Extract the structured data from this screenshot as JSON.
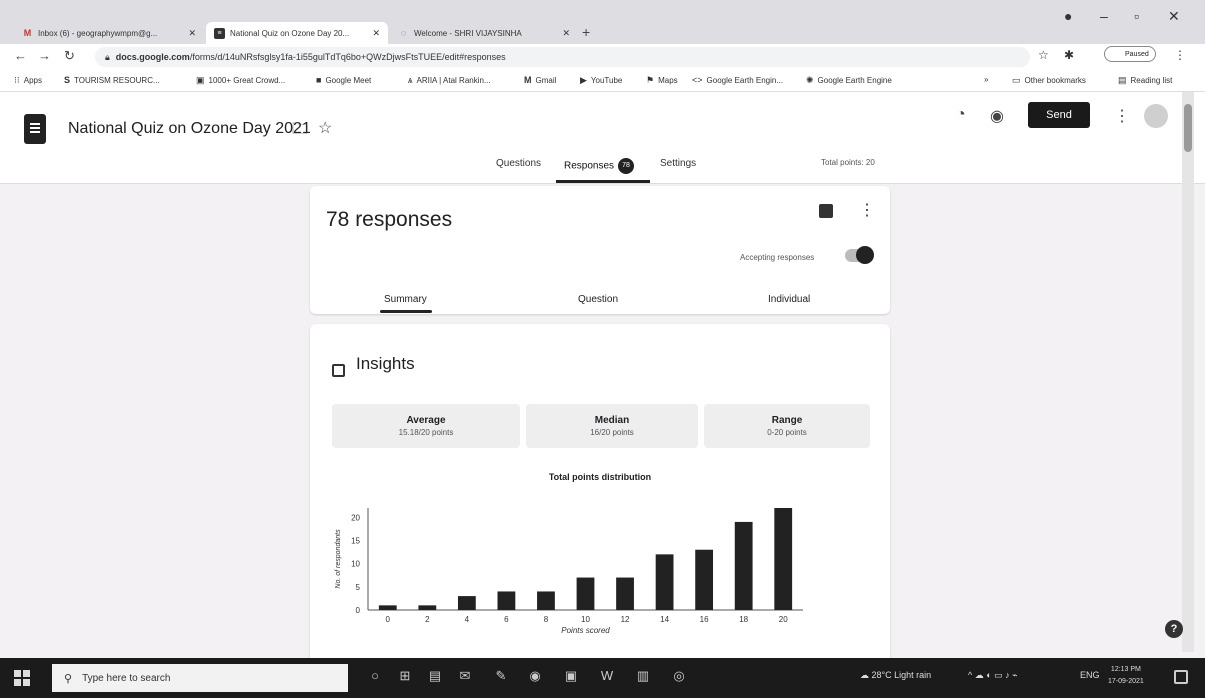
{
  "browser": {
    "tabs": [
      {
        "title": "Inbox (6) - geographywmpm@g...",
        "icon": "gmail-icon"
      },
      {
        "title": "National Quiz on Ozone Day 20...",
        "icon": "forms-icon",
        "active": true
      },
      {
        "title": "Welcome - SHRI VIJAYSINHA",
        "icon": "globe-icon"
      }
    ],
    "url_prefix": "docs.google.com",
    "url_rest": "/forms/d/14uNRsfsglsy1fa-1i55gulTdTq6bo+QWzDjwsFtsTUEE/edit#responses",
    "profile": "Paused",
    "bookmarks": [
      {
        "label": "Apps",
        "icon": "apps-icon"
      },
      {
        "label": "TOURISM RESOURC...",
        "icon": "s-icon"
      },
      {
        "label": "1000+ Great Crowd...",
        "icon": "bookmark-icon"
      },
      {
        "label": "Google Meet",
        "icon": "meet-icon"
      },
      {
        "label": "ARIIA | Atal Rankin...",
        "icon": "ariia-icon"
      },
      {
        "label": "Gmail",
        "icon": "gmail-icon"
      },
      {
        "label": "YouTube",
        "icon": "youtube-icon"
      },
      {
        "label": "Maps",
        "icon": "maps-icon"
      },
      {
        "label": "Google Earth Engin...",
        "icon": "code-icon"
      },
      {
        "label": "Google Earth Engine",
        "icon": "earth-icon"
      }
    ],
    "other_bookmarks": "Other bookmarks",
    "reading_list": "Reading list",
    "more_bookmarks": "»"
  },
  "form": {
    "title": "National Quiz on Ozone Day 2021",
    "send_label": "Send",
    "tabs": {
      "questions": "Questions",
      "responses": "Responses",
      "settings": "Settings"
    },
    "responses_badge": "78",
    "total_points": "Total points: 20"
  },
  "responses_card": {
    "count_text": "78 responses",
    "accepting_text": "Accepting responses",
    "subtabs": {
      "summary": "Summary",
      "question": "Question",
      "individual": "Individual"
    }
  },
  "insights": {
    "title": "Insights",
    "stats": [
      {
        "label": "Average",
        "value": "15.18/20 points"
      },
      {
        "label": "Median",
        "value": "16/20 points"
      },
      {
        "label": "Range",
        "value": "0-20 points"
      }
    ]
  },
  "chart_data": {
    "type": "bar",
    "title": "Total points distribution",
    "xlabel": "Points scored",
    "ylabel": "No. of respondants",
    "categories": [
      "0",
      "2",
      "4",
      "6",
      "8",
      "10",
      "12",
      "14",
      "16",
      "18",
      "20"
    ],
    "values": [
      1,
      1,
      3,
      4,
      4,
      7,
      7,
      12,
      13,
      19,
      22
    ],
    "yticks": [
      0,
      5,
      10,
      15,
      20
    ],
    "ylim": [
      0,
      22
    ],
    "bar_color": "#222222"
  },
  "taskbar": {
    "search_placeholder": "Type here to search",
    "weather": "28°C  Light rain",
    "lang": "ENG",
    "time": "12:13 PM",
    "date": "17-09-2021",
    "apps": [
      "cortana-icon",
      "task-view-icon",
      "file-explorer-icon",
      "mail-icon",
      "paint-icon",
      "chrome-icon",
      "photos-icon",
      "word-icon",
      "files-icon",
      "camera-icon"
    ]
  }
}
